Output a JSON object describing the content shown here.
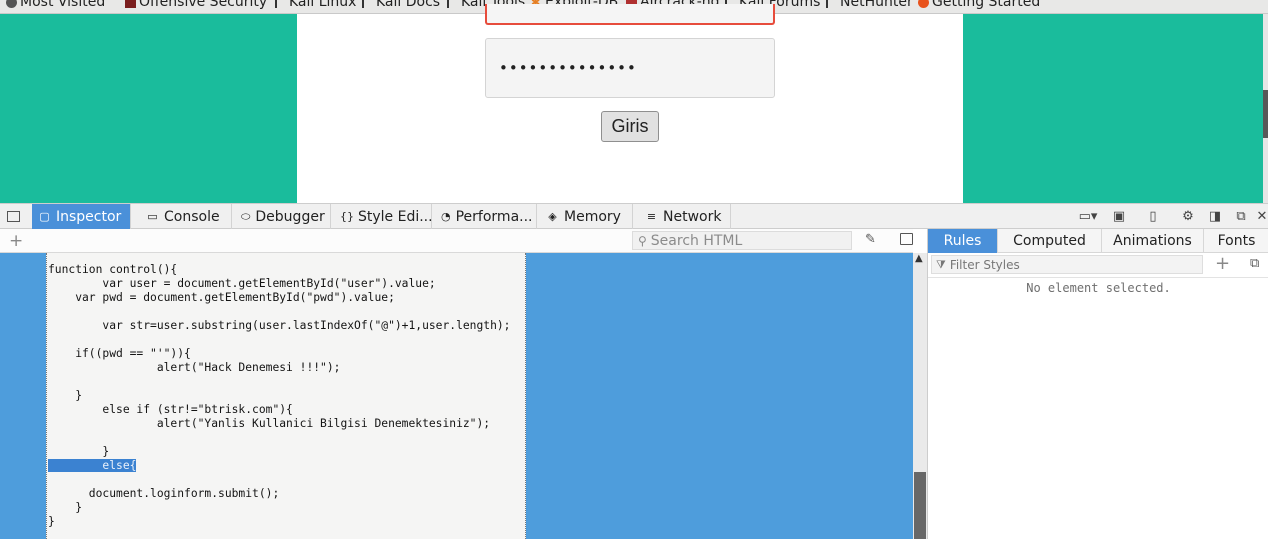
{
  "bookmarks": [
    {
      "label": "Most Visited",
      "icon": "gear-icon"
    },
    {
      "label": "Offensive Security",
      "icon": "offsec-icon"
    },
    {
      "label": "Kali Linux",
      "icon": "kali-icon"
    },
    {
      "label": "Kali Docs",
      "icon": "kali-icon"
    },
    {
      "label": "Kali Tools",
      "icon": "kali-icon"
    },
    {
      "label": "Exploit-DB",
      "icon": "exploitdb-icon"
    },
    {
      "label": "Aircrack-ng",
      "icon": "aircrack-icon"
    },
    {
      "label": "Kali Forums",
      "icon": "kali-icon"
    },
    {
      "label": "NetHunter",
      "icon": "kali-icon"
    },
    {
      "label": "Getting Started",
      "icon": "firefox-icon"
    }
  ],
  "page": {
    "password_value": "••••••••••••••",
    "login_button": "Giris",
    "colors": {
      "background": "#1abc9c",
      "card": "#ffffff",
      "error_border": "#e74c3c"
    }
  },
  "devtools": {
    "tabs": [
      {
        "label": "Inspector",
        "icon": "inspector-icon",
        "active": true
      },
      {
        "label": "Console",
        "icon": "console-icon"
      },
      {
        "label": "Debugger",
        "icon": "debugger-icon"
      },
      {
        "label": "Style Edi...",
        "icon": "style-editor-icon"
      },
      {
        "label": "Performa...",
        "icon": "performance-icon"
      },
      {
        "label": "Memory",
        "icon": "memory-icon"
      },
      {
        "label": "Network",
        "icon": "network-icon"
      }
    ],
    "search_placeholder": "Search HTML",
    "code": [
      {
        "text": "function control(){"
      },
      {
        "text": "        var user = document.getElementById(\"user\").value;"
      },
      {
        "text": "    var pwd = document.getElementById(\"pwd\").value;"
      },
      {
        "text": ""
      },
      {
        "text": "        var str=user.substring(user.lastIndexOf(\"@\")+1,user.length);"
      },
      {
        "text": ""
      },
      {
        "text": "    if((pwd == \"'\")){"
      },
      {
        "text": "                alert(\"Hack Denemesi !!!\");"
      },
      {
        "text": ""
      },
      {
        "text": "    }"
      },
      {
        "text": "        else if (str!=\"btrisk.com\"){"
      },
      {
        "text": "                alert(\"Yanlis Kullanici Bilgisi Denemektesiniz\");"
      },
      {
        "text": ""
      },
      {
        "text": "        }"
      },
      {
        "prefix": "        ",
        "text": "else{",
        "selected": true
      },
      {
        "text": ""
      },
      {
        "text": "      document.loginform.submit();"
      },
      {
        "text": "    }"
      },
      {
        "text": "}"
      }
    ],
    "sidebar": {
      "tabs": [
        "Rules",
        "Computed",
        "Animations",
        "Fonts"
      ],
      "active_tab": "Rules",
      "filter_placeholder": "Filter Styles",
      "empty_message": "No element selected."
    },
    "accent_color": "#4a90d9"
  }
}
